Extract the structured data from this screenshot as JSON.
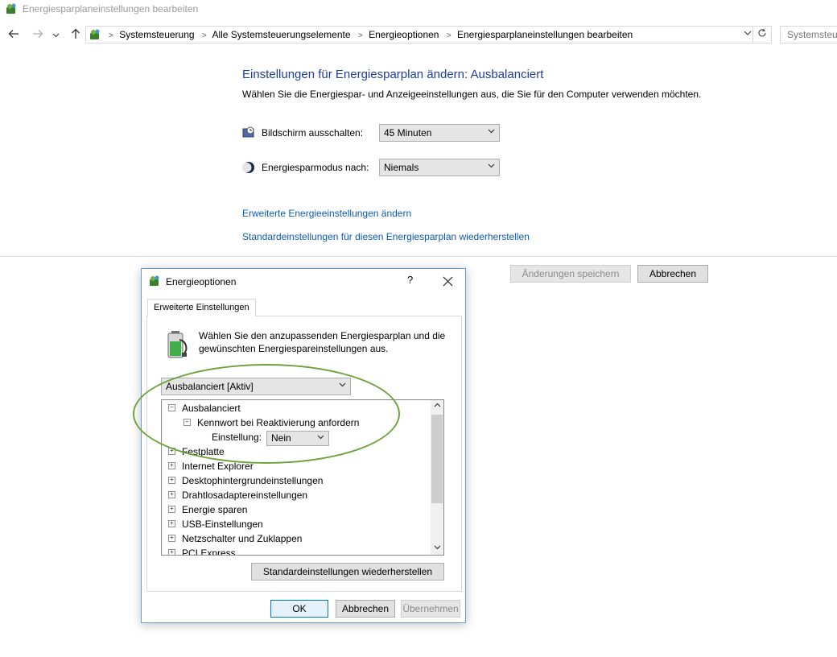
{
  "window": {
    "title": "Energiesparplaneinstellungen bearbeiten"
  },
  "nav": {
    "back_icon": "arrow-left-icon",
    "forward_icon": "arrow-right-icon",
    "recent_icon": "chevron-down-icon",
    "up_icon": "arrow-up-icon",
    "breadcrumbs": [
      "Systemsteuerung",
      "Alle Systemsteuerungselemente",
      "Energieoptionen",
      "Energiesparplaneinstellungen bearbeiten"
    ],
    "separator": ">",
    "search_placeholder": "Systemsteuerung durchsuchen"
  },
  "main": {
    "heading": "Einstellungen für Energiesparplan ändern: Ausbalanciert",
    "subheading": "Wählen Sie die Energiespar- und Anzeigeeinstellungen aus, die Sie für den Computer verwenden möchten.",
    "display_off": {
      "label": "Bildschirm ausschalten:",
      "value": "45 Minuten"
    },
    "sleep": {
      "label": "Energiesparmodus nach:",
      "value": "Niemals"
    },
    "link_advanced": "Erweiterte Energieeinstellungen ändern",
    "link_restore": "Standardeinstellungen für diesen Energiesparplan wiederherstellen",
    "save_button": "Änderungen speichern",
    "cancel_button": "Abbrechen"
  },
  "dialog": {
    "title": "Energieoptionen",
    "help": "?",
    "close": "✕",
    "tab": "Erweiterte Einstellungen",
    "intro": "Wählen Sie den anzupassenden Energiesparplan und die gewünschten Energiespareinstellungen aus.",
    "plan_select": "Ausbalanciert [Aktiv]",
    "tree": {
      "root": "Ausbalanciert",
      "child": "Kennwort bei Reaktivierung anfordern",
      "setting_label": "Einstellung:",
      "setting_value": "Nein",
      "items": [
        "Festplatte",
        "Internet Explorer",
        "Desktophintergrundeinstellungen",
        "Drahtlosadaptereinstellungen",
        "Energie sparen",
        "USB-Einstellungen",
        "Netzschalter und Zuklappen",
        "PCI Express"
      ]
    },
    "restore_button": "Standardeinstellungen wiederherstellen",
    "ok_button": "OK",
    "cancel_button": "Abbrechen",
    "apply_button": "Übernehmen"
  },
  "colors": {
    "heading": "#1e3e9a",
    "link": "#0b5bb5",
    "highlight_ellipse": "#6fa23d",
    "dialog_border": "#6a9bd1"
  }
}
